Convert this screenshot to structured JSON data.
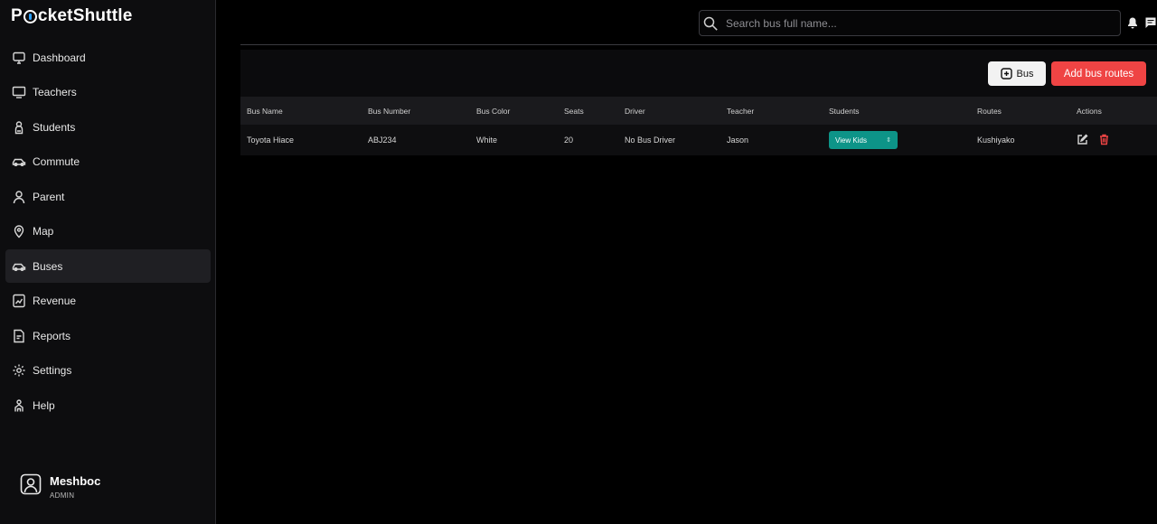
{
  "brand": {
    "name_prefix": "P",
    "name_suffix": "cketShuttle"
  },
  "sidebar": {
    "items": [
      {
        "label": "Dashboard",
        "icon": "monitor-icon"
      },
      {
        "label": "Teachers",
        "icon": "screen-icon"
      },
      {
        "label": "Students",
        "icon": "student-icon"
      },
      {
        "label": "Commute",
        "icon": "car-icon"
      },
      {
        "label": "Parent",
        "icon": "person-icon"
      },
      {
        "label": "Map",
        "icon": "map-pin-icon"
      },
      {
        "label": "Buses",
        "icon": "bus-icon",
        "active": true
      },
      {
        "label": "Revenue",
        "icon": "chart-icon"
      },
      {
        "label": "Reports",
        "icon": "report-icon"
      },
      {
        "label": "Settings",
        "icon": "gear-icon"
      },
      {
        "label": "Help",
        "icon": "help-icon"
      }
    ],
    "user": {
      "name": "Meshboc",
      "role": "ADMIN"
    }
  },
  "header": {
    "search_placeholder": "Search bus full name..."
  },
  "toolbar": {
    "bus_label": "Bus",
    "add_routes_label": "Add bus routes"
  },
  "table": {
    "headers": [
      "Bus Name",
      "Bus Number",
      "Bus Color",
      "Seats",
      "Driver",
      "Teacher",
      "Students",
      "Routes",
      "Actions"
    ],
    "rows": [
      {
        "bus_name": "Toyota Hiace",
        "bus_number": "ABJ234",
        "bus_color": "White",
        "seats": "20",
        "driver": "No Bus Driver",
        "teacher": "Jason",
        "students_button": "View Kids",
        "routes": "Kushiyako"
      }
    ]
  },
  "colors": {
    "accent_red": "#ef4444",
    "accent_teal": "#0d9488",
    "background": "#000000"
  }
}
